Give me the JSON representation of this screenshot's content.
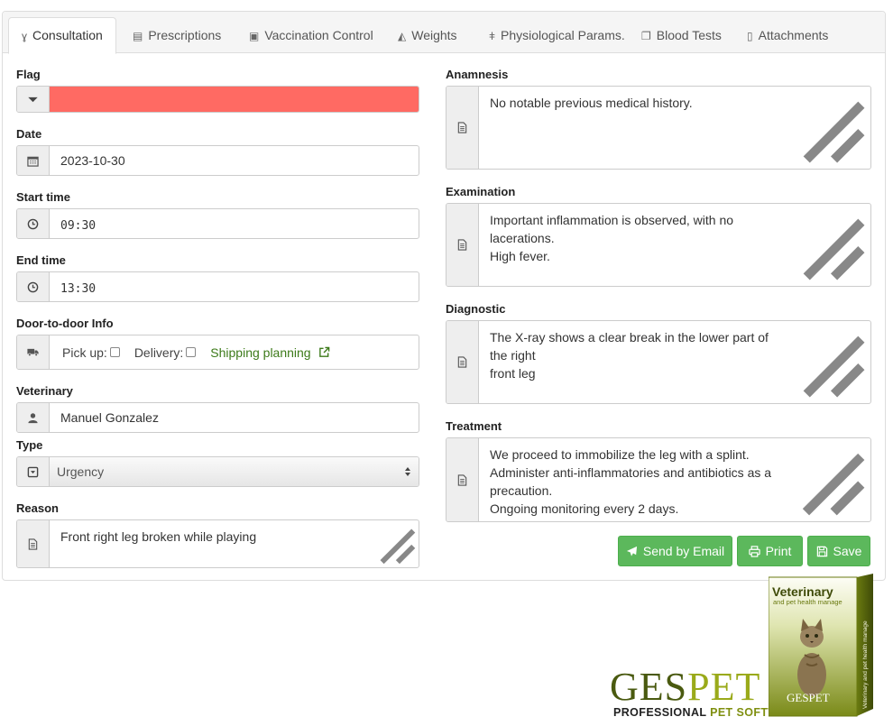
{
  "tabs": [
    {
      "label": "Consultation",
      "icon": "stethoscope-icon",
      "active": true
    },
    {
      "label": "Prescriptions",
      "icon": "list-icon",
      "active": false
    },
    {
      "label": "Vaccination Control",
      "icon": "medkit-icon",
      "active": false
    },
    {
      "label": "Weights",
      "icon": "area-chart-icon",
      "active": false
    },
    {
      "label": "Physiological Params.",
      "icon": "thermometer-icon",
      "active": false
    },
    {
      "label": "Blood Tests",
      "icon": "copy-icon",
      "active": false
    },
    {
      "label": "Attachments",
      "icon": "file-icon",
      "active": false
    }
  ],
  "left": {
    "flag": {
      "label": "Flag",
      "color": "#ff6a63"
    },
    "date": {
      "label": "Date",
      "value": "2023-10-30"
    },
    "start_time": {
      "label": "Start time",
      "value": "09:30"
    },
    "end_time": {
      "label": "End time",
      "value": "13:30"
    },
    "door": {
      "label": "Door-to-door Info",
      "pickup_label": "Pick up:",
      "delivery_label": "Delivery:",
      "link_label": "Shipping planning"
    },
    "veterinary": {
      "label": "Veterinary",
      "value": "Manuel Gonzalez"
    },
    "type": {
      "label": "Type",
      "value": "Urgency"
    },
    "reason": {
      "label": "Reason",
      "value": "Front right leg broken while playing"
    }
  },
  "right": {
    "anamnesis": {
      "label": "Anamnesis",
      "value": "No notable previous medical history."
    },
    "examination": {
      "label": "Examination",
      "value": "Important inflammation is observed, with no lacerations.\nHigh fever."
    },
    "diagnostic": {
      "label": "Diagnostic",
      "value": "The X-ray shows a clear break in the lower part of the right\nfront leg"
    },
    "treatment": {
      "label": "Treatment",
      "value": "We proceed to immobilize the leg with a splint.\nAdminister anti-inflammatories and antibiotics as a\nprecaution.\nOngoing monitoring every 2 days."
    }
  },
  "buttons": {
    "send_email": "Send by Email",
    "print": "Print",
    "save": "Save"
  },
  "brand": {
    "logo_ges": "GES",
    "logo_pet": "PET",
    "tagline_a": "PROFESSIONAL ",
    "tagline_b": "PET SOFTWARE",
    "box_title": "Veterinary",
    "box_subtitle": "and pet health manage",
    "box_logo": "GESPET",
    "colors": {
      "accent": "#5cb85c",
      "olive": "#8a9a1a",
      "dark_olive": "#4a5a10"
    }
  }
}
